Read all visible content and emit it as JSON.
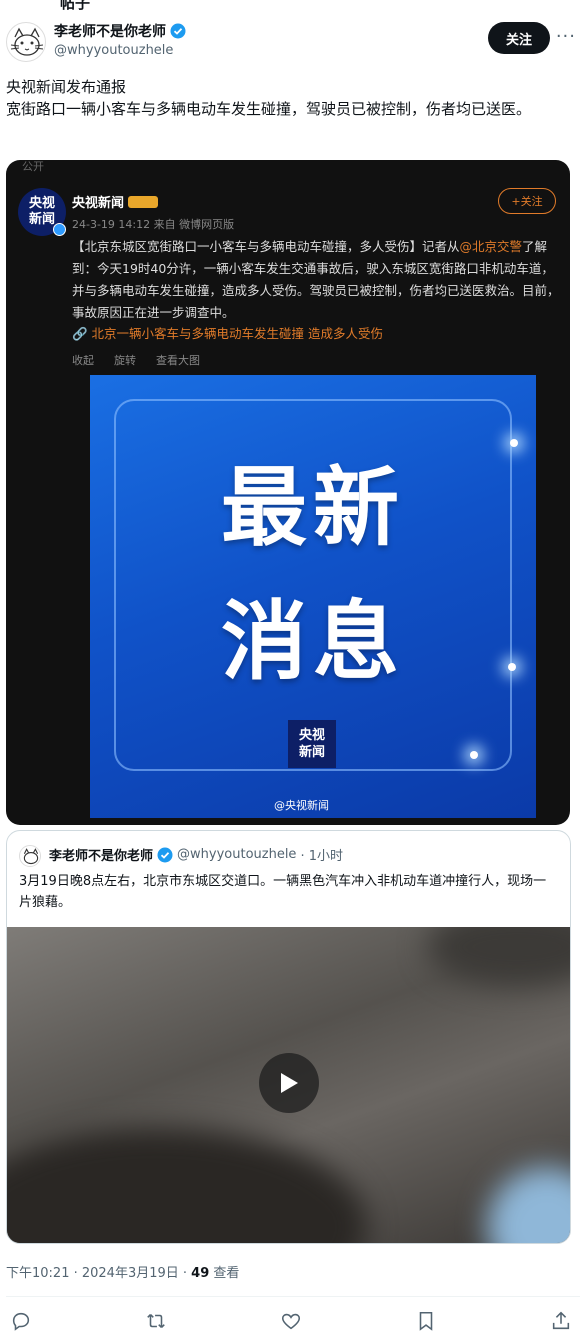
{
  "cut_top": "帖子",
  "author": {
    "name": "李老师不是你老师",
    "handle": "@whyyoutouzhele"
  },
  "follow_label": "关注",
  "more_label": "···",
  "post": {
    "line1": "央视新闻发布通报",
    "line2": "宽街路口一辆小客车与多辆电动车发生碰撞，驾驶员已被控制，伤者均已送医。"
  },
  "weibo": {
    "faded": "公开",
    "logo": "央视\n新闻",
    "account": "央视新闻",
    "meta": "24-3-19 14:12  来自 微博网页版",
    "follow": "+关注",
    "body_a": "【北京东城区宽街路口一小客车与多辆电动车碰撞，多人受伤】记者从",
    "body_at": "@北京交警",
    "body_b": "了解到：今天19时40分许，一辆小客车发生交通事故后，驶入东城区宽街路口非机动车道，并与多辆电动车发生碰撞，造成多人受伤。驾驶员已被控制，伤者均已送医救治。目前，事故原因正在进一步调查中。",
    "tag": "🔗 北京一辆小客车与多辆电动车发生碰撞 造成多人受伤",
    "actions": [
      "收起",
      "旋转",
      "查看大图"
    ],
    "img_big1": "最新",
    "img_big2": "消息",
    "img_logo": "央视\n新闻",
    "watermark": "@央视新闻"
  },
  "quote": {
    "name": "李老师不是你老师",
    "handle": "@whyyoutouzhele",
    "time": "· 1小时",
    "text": "3月19日晚8点左右，北京市东城区交道口。一辆黑色汽车冲入非机动车道冲撞行人，现场一片狼藉。"
  },
  "timestamp": "下午10:21 · 2024年3月19日 · ",
  "views_count": "49",
  "views_label": " 查看",
  "icons": [
    "reply-icon",
    "retweet-icon",
    "like-icon",
    "bookmark-icon",
    "share-icon"
  ]
}
